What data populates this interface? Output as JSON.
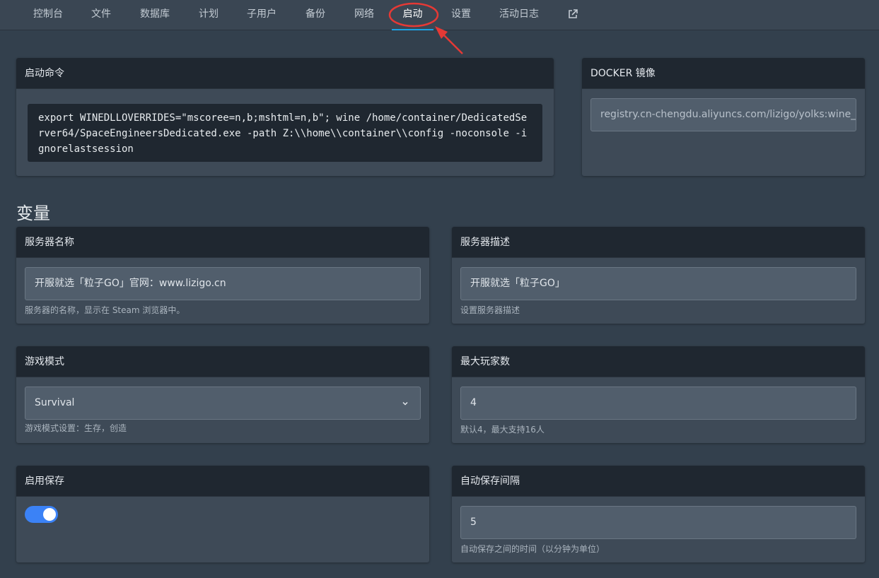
{
  "nav": {
    "tabs": [
      "控制台",
      "文件",
      "数据库",
      "计划",
      "子用户",
      "备份",
      "网络",
      "启动",
      "设置",
      "活动日志"
    ],
    "active_tab": "启动",
    "external_icon": "external-link-icon"
  },
  "startup": {
    "title": "启动命令",
    "command": "export WINEDLLOVERRIDES=\"mscoree=n,b;mshtml=n,b\"; wine /home/container/DedicatedServer64/SpaceEngineersDedicated.exe -path Z:\\\\home\\\\container\\\\config -noconsole -ignorelastsession"
  },
  "docker": {
    "title": "DOCKER 镜像",
    "image": "registry.cn-chengdu.aliyuncs.com/lizigo/yolks:wine_l"
  },
  "variables": {
    "heading": "变量",
    "server_name": {
      "title": "服务器名称",
      "value": "开服就选「粒子GO」官网：www.lizigo.cn",
      "hint": "服务器的名称，显示在 Steam 浏览器中。"
    },
    "server_desc": {
      "title": "服务器描述",
      "value": "开服就选「粒子GO」",
      "hint": "设置服务器描述"
    },
    "game_mode": {
      "title": "游戏模式",
      "value": "Survival",
      "hint": "游戏模式设置：生存，创造"
    },
    "max_players": {
      "title": "最大玩家数",
      "value": "4",
      "hint": "默认4，最大支持16人"
    },
    "enable_save": {
      "title": "启用保存",
      "enabled": true
    },
    "autosave_interval": {
      "title": "自动保存间隔",
      "value": "5",
      "hint": "自动保存之间的时间（以分钟为单位）"
    }
  },
  "colors": {
    "accent": "#19a3e6",
    "toggle_on": "#3b82f6",
    "annotation": "#e53935"
  }
}
